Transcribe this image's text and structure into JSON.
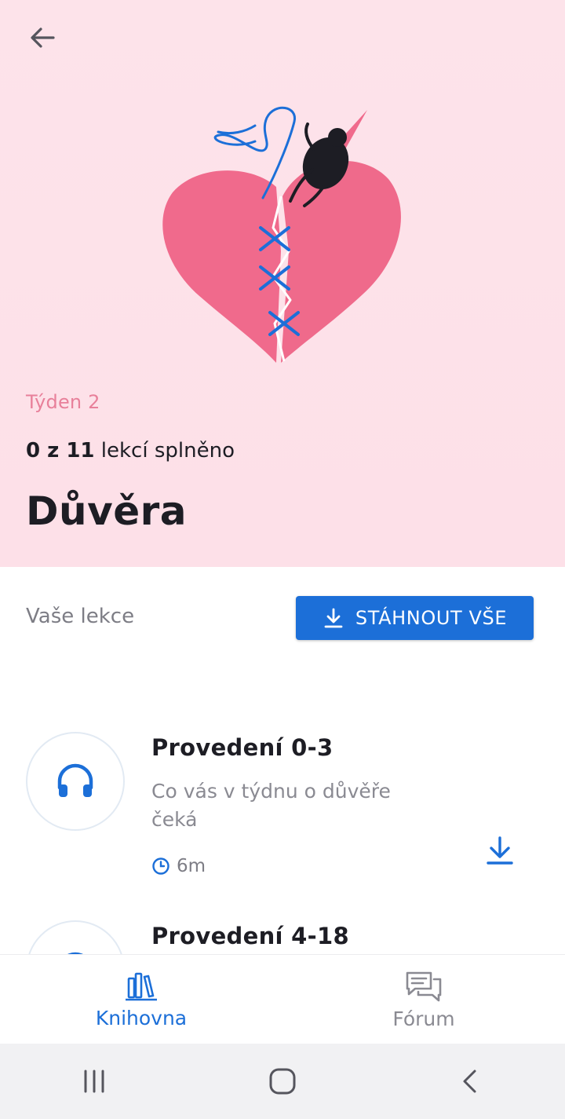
{
  "header": {
    "week_label": "Týden 2",
    "progress_completed": "0 z 11",
    "progress_suffix": "lekcí splněno",
    "course_title": "Důvěra"
  },
  "lessons_section": {
    "label": "Vaše lekce",
    "download_all_label": "STÁHNOUT VŠE"
  },
  "lessons": [
    {
      "title": "Provedení 0-3",
      "description": "Co vás v týdnu o důvěře čeká",
      "duration": "6m",
      "icon": "headphones-icon"
    },
    {
      "title": "Provedení 4-18",
      "description": "",
      "duration": "",
      "icon": "headphones-icon"
    }
  ],
  "bottom_nav": {
    "items": [
      {
        "label": "Knihovna",
        "icon": "library-icon",
        "active": true
      },
      {
        "label": "Fórum",
        "icon": "forum-icon",
        "active": false
      }
    ]
  },
  "colors": {
    "accent": "#1c6fd8",
    "hero_background": "#fde3ea",
    "week_label": "#e8809a",
    "heart": "#f06a8c"
  }
}
